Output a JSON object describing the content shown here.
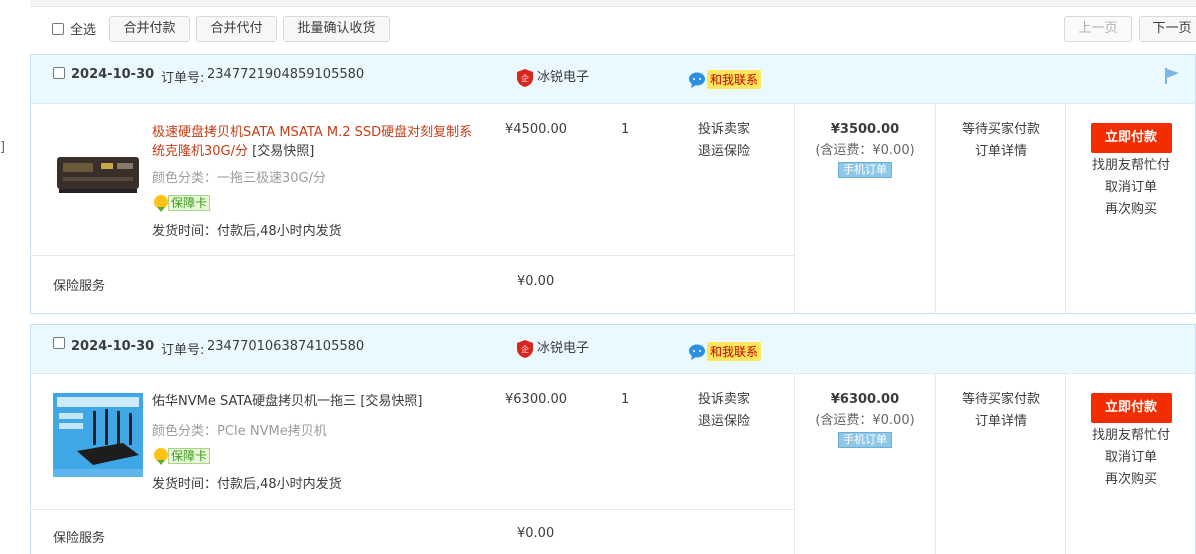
{
  "toolbar": {
    "select_all": "全选",
    "merge_pay": "合并付款",
    "merge_proxy_pay": "合并代付",
    "batch_confirm": "批量确认收货",
    "prev_page": "上一页",
    "next_page": "下一页"
  },
  "side_bracket": "]",
  "orders": [
    {
      "date": "2024-10-30",
      "order_no_label": "订单号:",
      "order_no": "2347721904859105580",
      "shop": "冰锐电子",
      "contact": "和我联系",
      "item_title": "极速硬盘拷贝机SATA MSATA M.2 SSD硬盘对刻复制系统克隆机30G/分",
      "snapshot": "[交易快照]",
      "sku": "颜色分类：一拖三极速30G/分",
      "guarantee": "保障卡",
      "ship_time": "发货时间：付款后,48小时内发货",
      "price": "¥4500.00",
      "quantity": "1",
      "op_complain": "投诉卖家",
      "op_insurance": "退运保险",
      "total": "¥3500.00",
      "shipping_fee": "(含运费：¥0.00)",
      "mobile_order": "手机订单",
      "status": "等待买家付款",
      "details": "订单详情",
      "pay_now": "立即付款",
      "ask_friend": "找朋友帮忙付",
      "cancel": "取消订单",
      "rebuy": "再次购买",
      "insurance_service": "保险服务",
      "insurance_price": "¥0.00"
    },
    {
      "date": "2024-10-30",
      "order_no_label": "订单号:",
      "order_no": "2347701063874105580",
      "shop": "冰锐电子",
      "contact": "和我联系",
      "item_title": "佑华NVMe SATA硬盘拷贝机一拖三",
      "snapshot": "[交易快照]",
      "sku": "颜色分类：PCIe NVMe拷贝机",
      "guarantee": "保障卡",
      "ship_time": "发货时间：付款后,48小时内发货",
      "price": "¥6300.00",
      "quantity": "1",
      "op_complain": "投诉卖家",
      "op_insurance": "退运保险",
      "total": "¥6300.00",
      "shipping_fee": "(含运费：¥0.00)",
      "mobile_order": "手机订单",
      "status": "等待买家付款",
      "details": "订单详情",
      "pay_now": "立即付款",
      "ask_friend": "找朋友帮忙付",
      "cancel": "取消订单",
      "rebuy": "再次购买",
      "insurance_service": "保险服务",
      "insurance_price": "¥0.00"
    }
  ],
  "icons": {
    "shop": "shield-shop-icon",
    "contact": "chat-bubble-icon",
    "flag": "flag-icon",
    "guarantee": "guarantee-badge-icon"
  },
  "colors": {
    "accent_orange": "#f22e00",
    "title_red": "#c33d16",
    "header_blue": "#eaf8ff",
    "border_blue": "#c4e1f3"
  }
}
